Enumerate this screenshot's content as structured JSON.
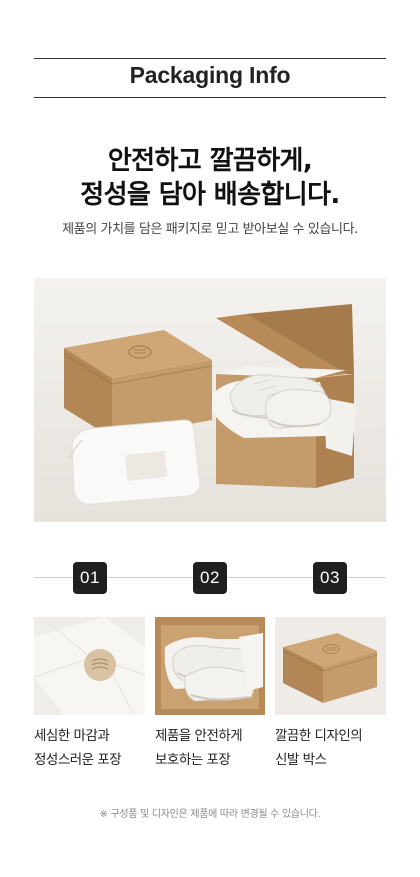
{
  "header": {
    "title": "Packaging Info"
  },
  "hero": {
    "headline_line1": "안전하고 깔끔하게,",
    "headline_line2": "정성을 담아 배송합니다.",
    "subtitle": "제품의 가치를 담은 패키지로 믿고 받아보실 수 있습니다."
  },
  "steps": [
    {
      "number": "01",
      "caption": "세심한 마감과\n정성스러운 포장"
    },
    {
      "number": "02",
      "caption": "제품을 안전하게\n보호하는 포장"
    },
    {
      "number": "03",
      "caption": "깔끔한 디자인의\n신발 박스"
    }
  ],
  "footnote": "※ 구성품 및 디자인은 제품에 따라 변경될 수 있습니다.",
  "colors": {
    "kraft": "#c29a6b",
    "kraft_dark": "#9c774c",
    "background_photo": "#efece8",
    "badge": "#1f1f1f"
  }
}
